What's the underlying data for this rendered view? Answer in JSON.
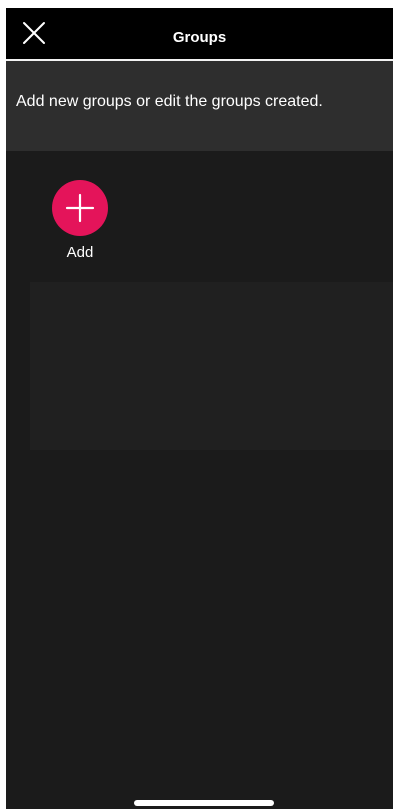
{
  "header": {
    "title": "Groups",
    "close_icon": "close-icon"
  },
  "info": {
    "text": "Add new groups or edit the groups created."
  },
  "add_action": {
    "label": "Add",
    "icon": "plus-icon",
    "color": "#e4145a"
  },
  "colors": {
    "background": "#1b1b1b",
    "topbar": "#000000",
    "info_band": "#2e2e2e",
    "accent": "#e4145a"
  }
}
